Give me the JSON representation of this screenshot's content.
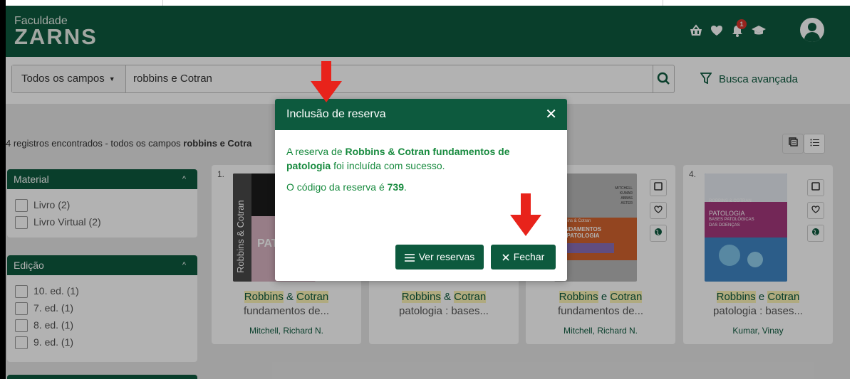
{
  "header": {
    "logo_top": "Faculdade",
    "logo_main": "ZARNS",
    "notification_count": "1"
  },
  "search": {
    "field_select": "Todos os campos",
    "query": "robbins e Cotran",
    "advanced_label": "Busca avançada"
  },
  "results": {
    "count_prefix": "4 registros encontrados - todos os campos ",
    "count_query": "robbins e Cotra"
  },
  "facets": {
    "material": {
      "title": "Material",
      "items": [
        "Livro (2)",
        "Livro Virtual (2)"
      ]
    },
    "edicao": {
      "title": "Edição",
      "items": [
        "10. ed. (1)",
        "7. ed. (1)",
        "8. ed. (1)",
        "9. ed. (1)"
      ]
    }
  },
  "cards": [
    {
      "num": "1.",
      "title_a": "Robbins",
      "title_amp": " & ",
      "title_b": "Cotran",
      "title_rest": "fundamentos de...",
      "author": "Mitchell, Richard N.",
      "cover_text_1": "Robbins & Cotran",
      "cover_text_2": "PAT"
    },
    {
      "num": "",
      "title_a": "Robbins",
      "title_amp": " & ",
      "title_b": "Cotran",
      "title_rest": "patologia : bases...",
      "author": ""
    },
    {
      "num": "",
      "title_a": "Robbins",
      "title_amp": " e ",
      "title_b": "Cotran",
      "title_rest": "fundamentos de...",
      "author": "Mitchell, Richard N.",
      "cover_text_1": "MITCHELL",
      "cover_text_2": "KUMAR",
      "cover_text_3": "ABBAS",
      "cover_text_4": "ASTER",
      "cover_text_5": "Robbins & Cotran",
      "cover_text_6": "FUNDAMENTOS",
      "cover_text_7": "DE PATOLOGIA"
    },
    {
      "num": "4.",
      "title_a": "Robbins",
      "title_amp": " e ",
      "title_b": "Cotran",
      "title_rest": "patologia : bases...",
      "author": "Kumar, Vinay",
      "cover_text_1": "ROBBINS & COTRAN",
      "cover_text_2": "PATOLOGIA",
      "cover_text_3": "BASES PATOLÓGICAS",
      "cover_text_4": "DAS DOENÇAS"
    }
  ],
  "modal": {
    "title": "Inclusão de reserva",
    "msg_prefix": "A reserva de ",
    "msg_book": "Robbins & Cotran fundamentos de patologia",
    "msg_suffix": " foi incluída com sucesso.",
    "code_prefix": "O código da reserva é ",
    "code": "739",
    "code_suffix": ".",
    "btn_ver_reservas": "Ver reservas",
    "btn_fechar": "Fechar"
  },
  "colors": {
    "brand_green": "#0d5a3e",
    "success_text": "#178a3e",
    "annotation_arrow": "#e8231b"
  }
}
